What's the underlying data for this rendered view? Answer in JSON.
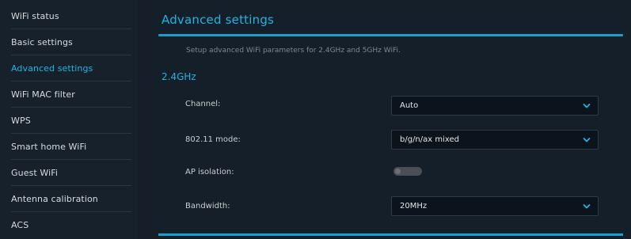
{
  "colors": {
    "accent": "#1fb4e3",
    "sidebar_bg": "#17212b",
    "main_bg": "#151f29",
    "select_bg": "#0b141c",
    "toggle_off": "#4a4f56"
  },
  "sidebar": {
    "items": [
      {
        "label": "WiFi status"
      },
      {
        "label": "Basic settings"
      },
      {
        "label": "Advanced settings",
        "active": true
      },
      {
        "label": "WiFi MAC filter"
      },
      {
        "label": "WPS"
      },
      {
        "label": "Smart home WiFi"
      },
      {
        "label": "Guest WiFi"
      },
      {
        "label": "Antenna calibration"
      },
      {
        "label": "ACS"
      }
    ]
  },
  "page": {
    "title": "Advanced settings",
    "description": "Setup advanced WiFi parameters for 2.4GHz and 5GHz WiFi.",
    "section_title": "2.4GHz"
  },
  "settings": {
    "channel": {
      "label": "Channel:",
      "value": "Auto",
      "icon": "chevron-down-icon"
    },
    "mode": {
      "label": "802.11 mode:",
      "value": "b/g/n/ax mixed",
      "icon": "chevron-down-icon"
    },
    "ap_isolation": {
      "label": "AP isolation:",
      "state": "off"
    },
    "bandwidth": {
      "label": "Bandwidth:",
      "value": "20MHz",
      "icon": "chevron-down-icon"
    }
  }
}
